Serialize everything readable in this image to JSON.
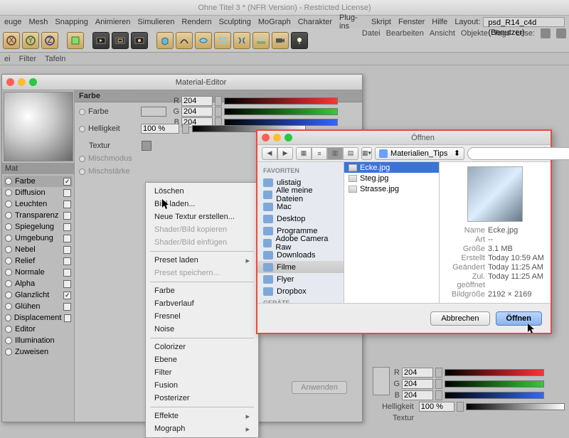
{
  "window_title": "Ohne Titel 3 * (NFR Version) - Restricted License)",
  "menubar": [
    "euge",
    "Mesh",
    "Snapping",
    "Animieren",
    "Simulieren",
    "Rendern",
    "Sculpting",
    "MoGraph",
    "Charakter",
    "Plug-ins",
    "Skript",
    "Fenster",
    "Hilfe"
  ],
  "layout_label": "Layout:",
  "layout_value": "psd_R14_c4d (Benutzer)",
  "secbar": [
    "ei",
    "Filter",
    "Tafeln"
  ],
  "rightmenu": [
    "Datei",
    "Bearbeiten",
    "Ansicht",
    "Objekte",
    "Tags",
    "Lese:"
  ],
  "mateditor": {
    "title": "Material-Editor",
    "side_title": "Mat",
    "section": "Farbe",
    "fields": {
      "farbe": "Farbe",
      "helligkeit": "Helligkeit",
      "helligkeit_val": "100 %",
      "textur": "Textur",
      "mischmodus": "Mischmodus",
      "mischstaerke": "Mischstärke"
    },
    "rgb": {
      "r_label": "R",
      "g_label": "G",
      "b_label": "B",
      "r": "204",
      "g": "204",
      "b": "204"
    },
    "channels": [
      {
        "name": "Farbe",
        "on": true,
        "sel": true
      },
      {
        "name": "Diffusion",
        "on": false
      },
      {
        "name": "Leuchten",
        "on": false
      },
      {
        "name": "Transparenz",
        "on": false
      },
      {
        "name": "Spiegelung",
        "on": false
      },
      {
        "name": "Umgebung",
        "on": false
      },
      {
        "name": "Nebel",
        "on": false
      },
      {
        "name": "Relief",
        "on": false
      },
      {
        "name": "Normale",
        "on": false
      },
      {
        "name": "Alpha",
        "on": false
      },
      {
        "name": "Glanzlicht",
        "on": true
      },
      {
        "name": "Glühen",
        "on": false
      },
      {
        "name": "Displacement",
        "on": false
      },
      {
        "name": "Editor",
        "on": null
      },
      {
        "name": "Illumination",
        "on": null
      },
      {
        "name": "Zuweisen",
        "on": null
      }
    ]
  },
  "ctx": {
    "items": [
      {
        "t": "Löschen"
      },
      {
        "t": "Bild laden..."
      },
      {
        "t": "Neue Textur erstellen..."
      },
      {
        "t": "Shader/Bild kopieren",
        "dim": true
      },
      {
        "t": "Shader/Bild einfügen",
        "dim": true
      },
      {
        "sep": true
      },
      {
        "t": "Preset laden",
        "sub": true
      },
      {
        "t": "Preset speichern...",
        "dim": true
      },
      {
        "sep": true
      },
      {
        "t": "Farbe"
      },
      {
        "t": "Farbverlauf"
      },
      {
        "t": "Fresnel"
      },
      {
        "t": "Noise"
      },
      {
        "sep": true
      },
      {
        "t": "Colorizer"
      },
      {
        "t": "Ebene"
      },
      {
        "t": "Filter"
      },
      {
        "t": "Fusion"
      },
      {
        "t": "Posterizer"
      },
      {
        "sep": true
      },
      {
        "t": "Effekte",
        "sub": true
      },
      {
        "t": "Mograph",
        "sub": true
      }
    ]
  },
  "filedlg": {
    "title": "Öffnen",
    "folder": "Materialien_Tips",
    "favoriten": "FAVORITEN",
    "geraete": "GERÄTE",
    "side": [
      {
        "t": "ulistaig"
      },
      {
        "t": "Alle meine Dateien"
      },
      {
        "t": "Mac"
      },
      {
        "t": "Desktop"
      },
      {
        "t": "Programme"
      },
      {
        "t": "Adobe Camera Raw"
      },
      {
        "t": "Downloads"
      },
      {
        "t": "Filme",
        "sel": true
      },
      {
        "t": "Flyer"
      },
      {
        "t": "Dropbox"
      }
    ],
    "files": [
      {
        "t": "Ecke.jpg",
        "sel": true
      },
      {
        "t": "Steg.jpg"
      },
      {
        "t": "Strasse.jpg"
      }
    ],
    "meta": {
      "name_k": "Name",
      "name_v": "Ecke.jpg",
      "art_k": "Art",
      "art_v": "--",
      "groesse_k": "Größe",
      "groesse_v": "3.1 MB",
      "erstellt_k": "Erstellt",
      "erstellt_v": "Today 10:59 AM",
      "geaendert_k": "Geändert",
      "geaendert_v": "Today 11:25 AM",
      "geoeffnet_k": "Zul. geöffnet",
      "geoeffnet_v": "Today 11:25 AM",
      "bildgroesse_k": "Bildgröße",
      "bildgroesse_v": "2192 × 2169"
    },
    "cancel": "Abbrechen",
    "open": "Öffnen"
  },
  "bottomright": {
    "rgb": {
      "r": "204",
      "g": "204",
      "b": "204"
    },
    "helligkeit": "Helligkeit",
    "helligkeit_val": "100 %",
    "textur": "Textur",
    "anwenden": "Anwenden"
  }
}
